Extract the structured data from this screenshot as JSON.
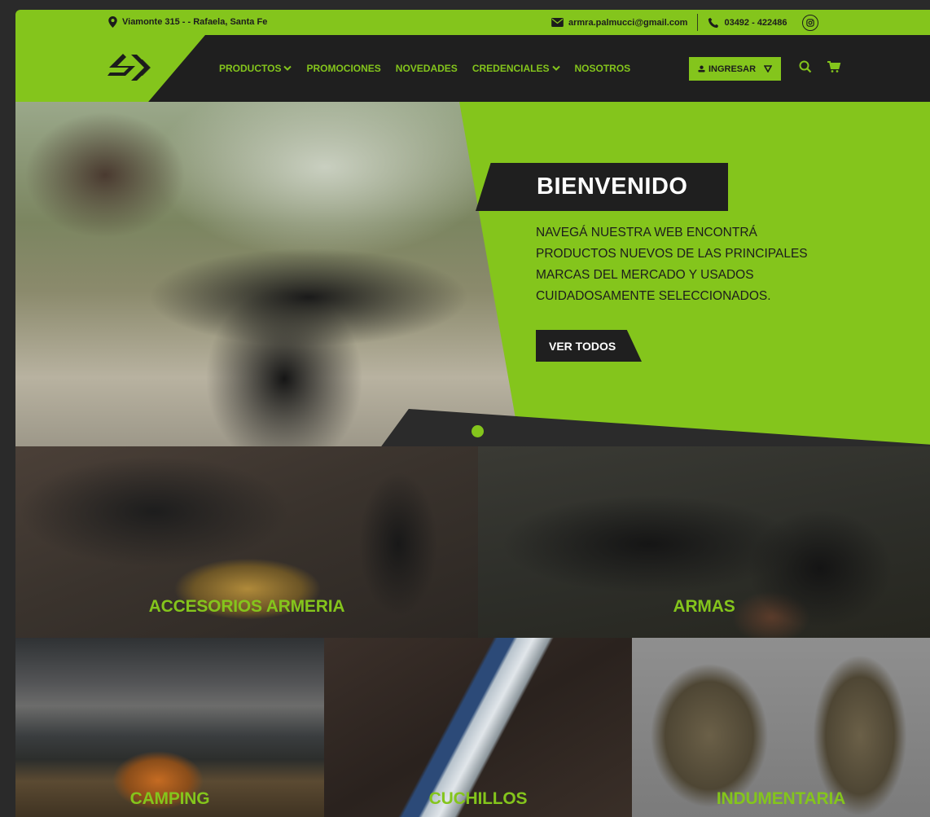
{
  "topbar": {
    "address": "Viamonte 315 - - Rafaela, Santa Fe",
    "email": "armra.palmucci@gmail.com",
    "phone": "03492 - 422486",
    "icons": [
      "map-pin-icon",
      "envelope-icon",
      "phone-icon",
      "instagram-icon"
    ]
  },
  "nav": {
    "items": [
      {
        "label": "PRODUCTOS",
        "dropdown": true
      },
      {
        "label": "PROMOCIONES",
        "dropdown": false
      },
      {
        "label": "NOVEDADES",
        "dropdown": false
      },
      {
        "label": "CREDENCIALES",
        "dropdown": true
      },
      {
        "label": "NOSOTROS",
        "dropdown": false
      }
    ],
    "login_label": "INGRESAR"
  },
  "hero": {
    "title": "BIENVENIDO",
    "description_lines": [
      "NAVEGÁ NUESTRA WEB ENCONTRÁ",
      "PRODUCTOS NUEVOS DE LAS PRINCIPALES",
      "MARCAS DEL MERCADO Y USADOS",
      "CUIDADOSAMENTE SELECCIONADOS."
    ],
    "button_label": "VER TODOS"
  },
  "categories": [
    {
      "label": "ACCESORIOS ARMERIA"
    },
    {
      "label": "ARMAS"
    },
    {
      "label": "CAMPING"
    },
    {
      "label": "CUCHILLOS"
    },
    {
      "label": "INDUMENTARIA"
    }
  ],
  "colors": {
    "accent": "#84c51c",
    "dark": "#1f1f1f"
  }
}
